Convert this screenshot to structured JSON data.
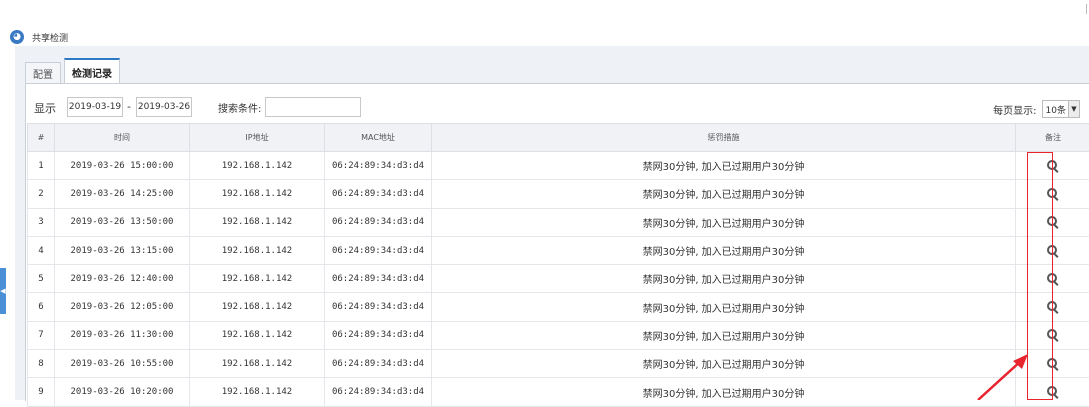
{
  "app": {
    "title": "共享检测"
  },
  "tabs": [
    {
      "label": "配置"
    },
    {
      "label": "检测记录"
    }
  ],
  "filter": {
    "show_label": "显示",
    "date_from": "2019-03-19",
    "date_sep": "-",
    "date_to": "2019-03-26",
    "search_label": "搜索条件:",
    "search_value": "",
    "per_page_label": "每页显示:",
    "per_page_value": "10条"
  },
  "table": {
    "headers": [
      "#",
      "时间",
      "IP地址",
      "MAC地址",
      "惩罚措施",
      "备注"
    ],
    "rows": [
      [
        "1",
        "2019-03-26 15:00:00",
        "192.168.1.142",
        "06:24:89:34:d3:d4",
        "禁网30分钟, 加入已过期用户30分钟"
      ],
      [
        "2",
        "2019-03-26 14:25:00",
        "192.168.1.142",
        "06:24:89:34:d3:d4",
        "禁网30分钟, 加入已过期用户30分钟"
      ],
      [
        "3",
        "2019-03-26 13:50:00",
        "192.168.1.142",
        "06:24:89:34:d3:d4",
        "禁网30分钟, 加入已过期用户30分钟"
      ],
      [
        "4",
        "2019-03-26 13:15:00",
        "192.168.1.142",
        "06:24:89:34:d3:d4",
        "禁网30分钟, 加入已过期用户30分钟"
      ],
      [
        "5",
        "2019-03-26 12:40:00",
        "192.168.1.142",
        "06:24:89:34:d3:d4",
        "禁网30分钟, 加入已过期用户30分钟"
      ],
      [
        "6",
        "2019-03-26 12:05:00",
        "192.168.1.142",
        "06:24:89:34:d3:d4",
        "禁网30分钟, 加入已过期用户30分钟"
      ],
      [
        "7",
        "2019-03-26 11:30:00",
        "192.168.1.142",
        "06:24:89:34:d3:d4",
        "禁网30分钟, 加入已过期用户30分钟"
      ],
      [
        "8",
        "2019-03-26 10:55:00",
        "192.168.1.142",
        "06:24:89:34:d3:d4",
        "禁网30分钟, 加入已过期用户30分钟"
      ],
      [
        "9",
        "2019-03-26 10:20:00",
        "192.168.1.142",
        "06:24:89:34:d3:d4",
        "禁网30分钟, 加入已过期用户30分钟"
      ]
    ]
  },
  "icons": {
    "row_action": "search-icon",
    "app_logo": "app-logo-icon"
  },
  "colors": {
    "tab_accent": "#2d7bc4",
    "highlight": "#e8242f"
  }
}
